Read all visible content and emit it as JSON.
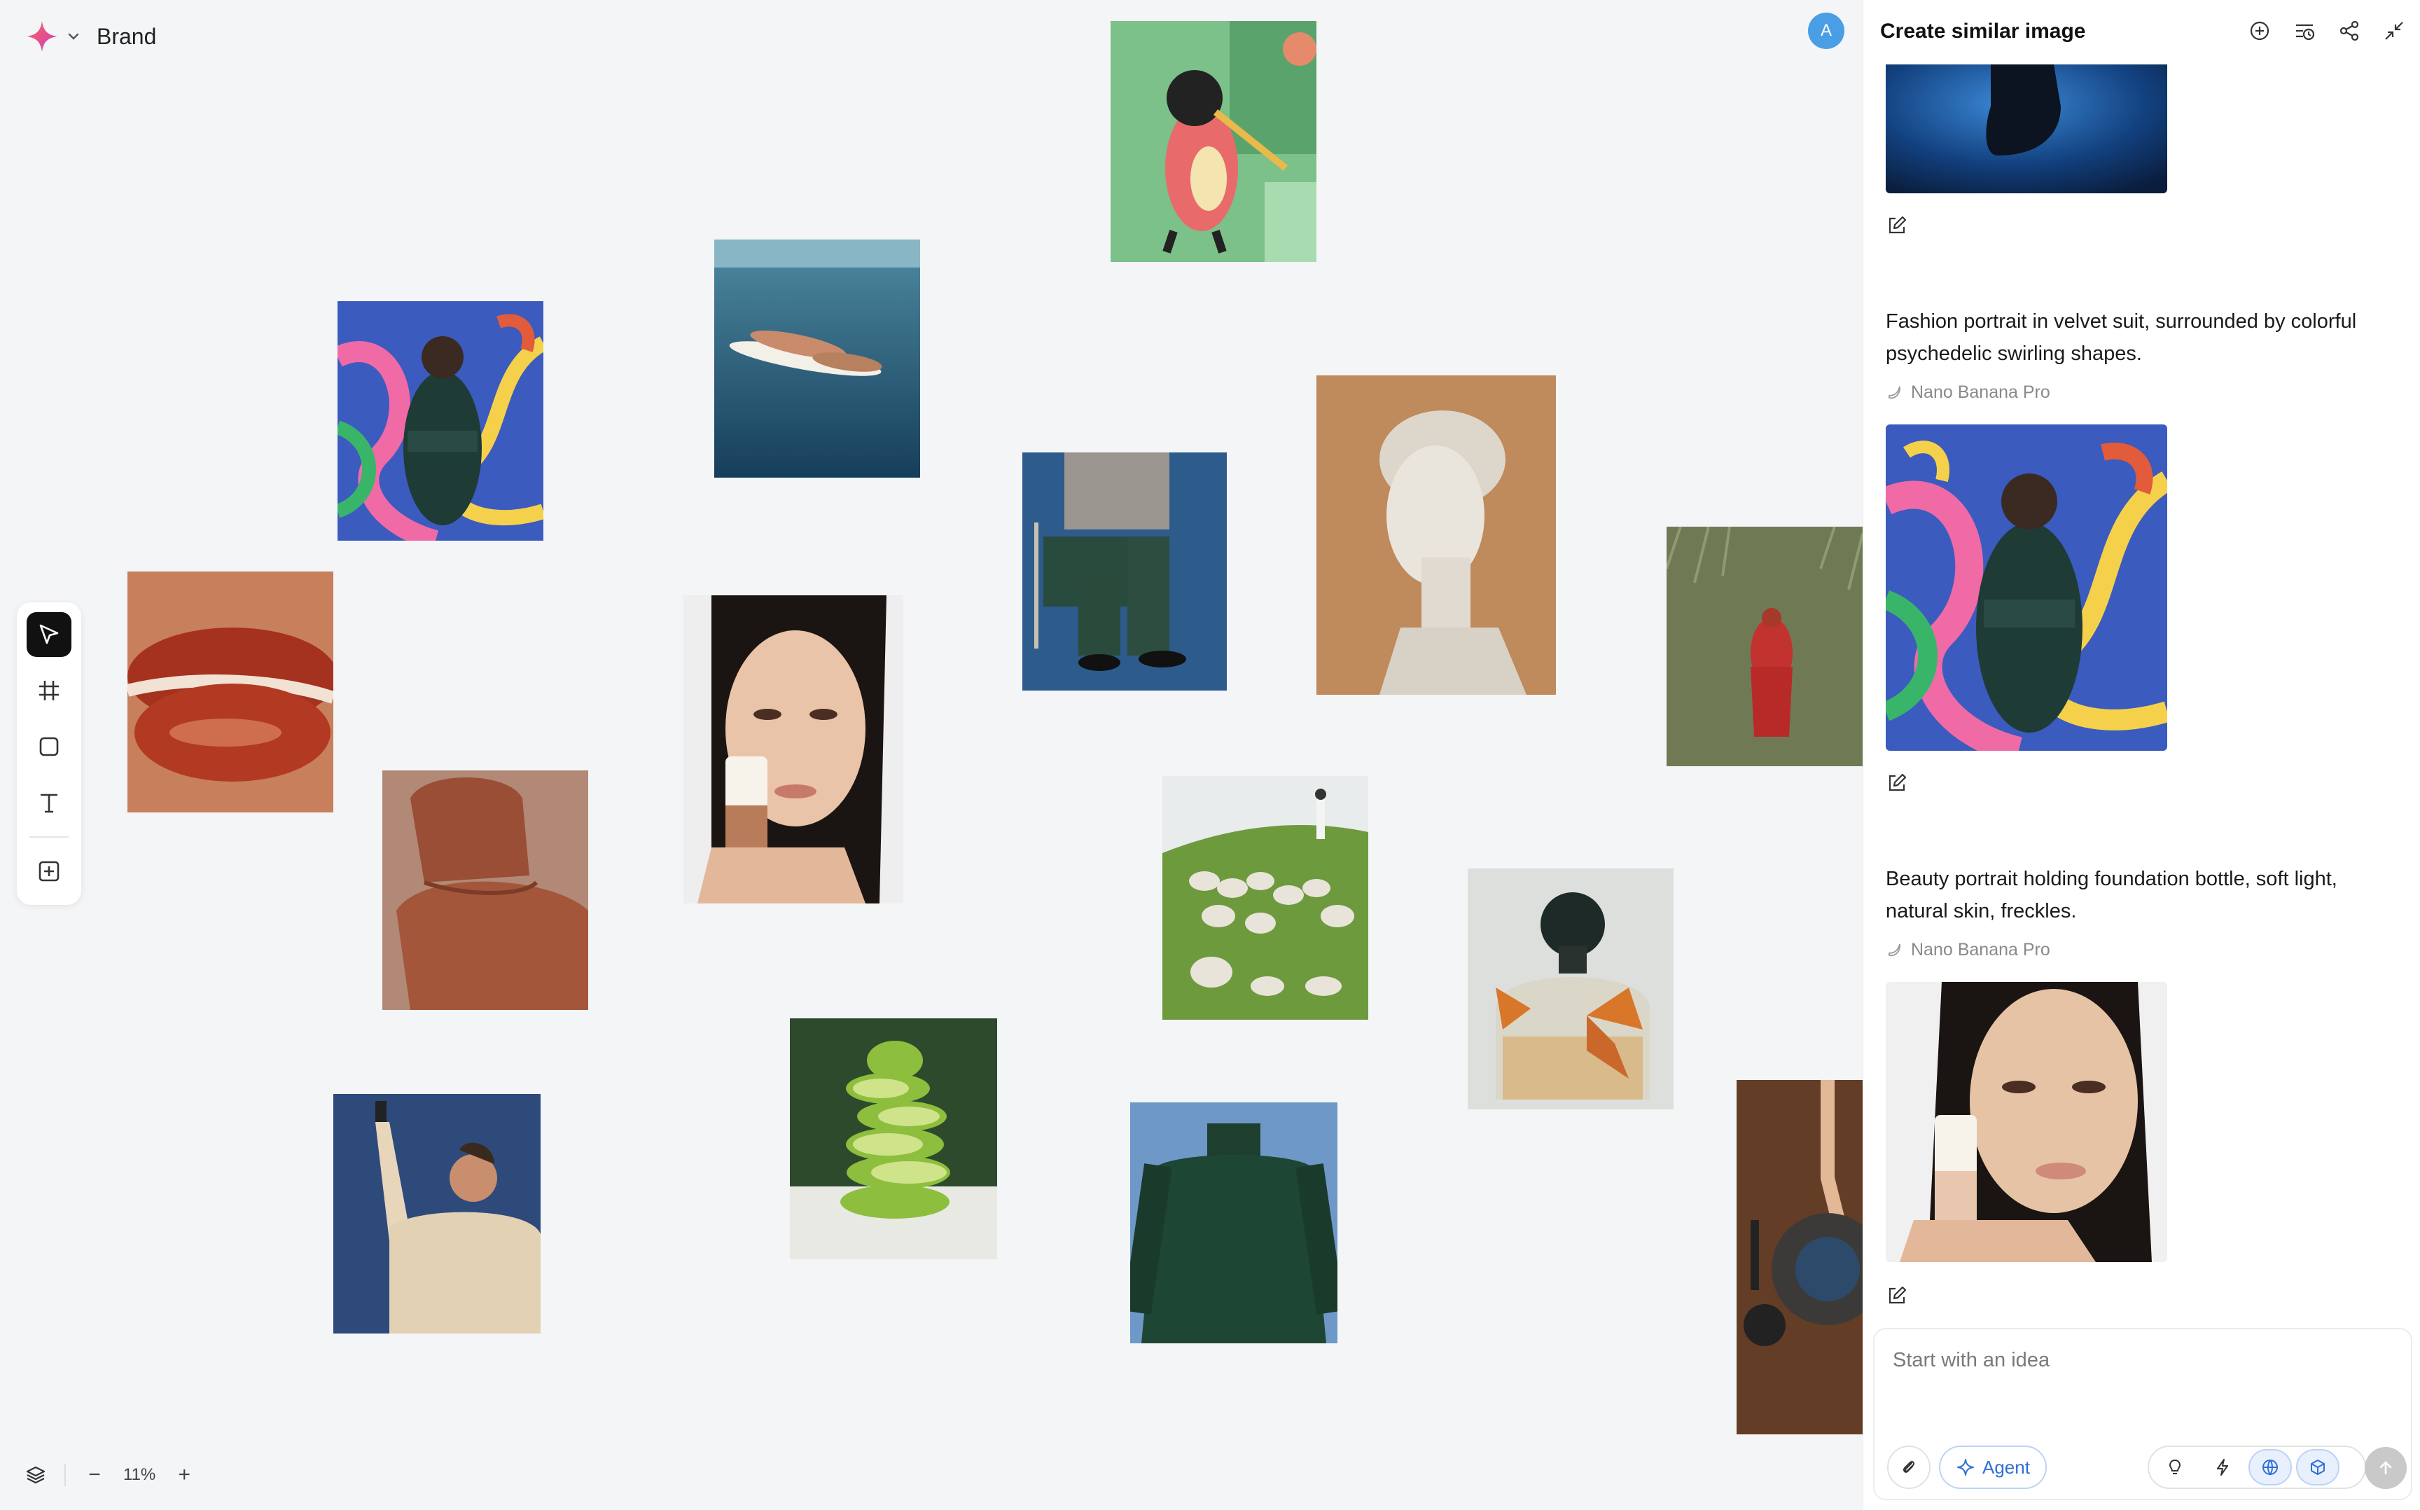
{
  "app": {
    "brand_name": "Brand",
    "avatar_initial": "A",
    "zoom_level": "11%",
    "zoom_out": "−",
    "zoom_in": "+"
  },
  "toolbar": {
    "tools": [
      "select-icon",
      "frame-icon",
      "rectangle-icon",
      "text-icon",
      "add-icon"
    ],
    "active_tool": "select-icon"
  },
  "canvas_images": [
    "Cat playing trombone illustration",
    "Fashion portrait with psychedelic shapes",
    "Underwater surfer",
    "Person seated in chair, green trousers",
    "Classical marble bust",
    "Woman in red dress in grass field",
    "Glossy red lips",
    "Beauty portrait with foundation bottle",
    "Terracotta armchair",
    "Sheep on green hill",
    "Perfume bottle with butterflies",
    "Man taking selfie in knit sweater",
    "Stacked lime slices",
    "Green turtleneck sweater",
    "Hands with bowl on wooden table"
  ],
  "panel": {
    "title": "Create similar image",
    "header_icons": [
      "new-chat-icon",
      "history-icon",
      "share-icon",
      "collapse-icon"
    ],
    "entries": [
      {
        "prompt": "Fashion portrait in velvet suit, surrounded by colorful psychedelic swirling shapes.",
        "model": "Nano Banana Pro"
      },
      {
        "prompt": "Beauty portrait holding foundation bottle, soft light, natural skin, freckles.",
        "model": "Nano Banana Pro"
      }
    ],
    "input": {
      "placeholder": "Start with an idea",
      "agent_label": "Agent"
    }
  }
}
